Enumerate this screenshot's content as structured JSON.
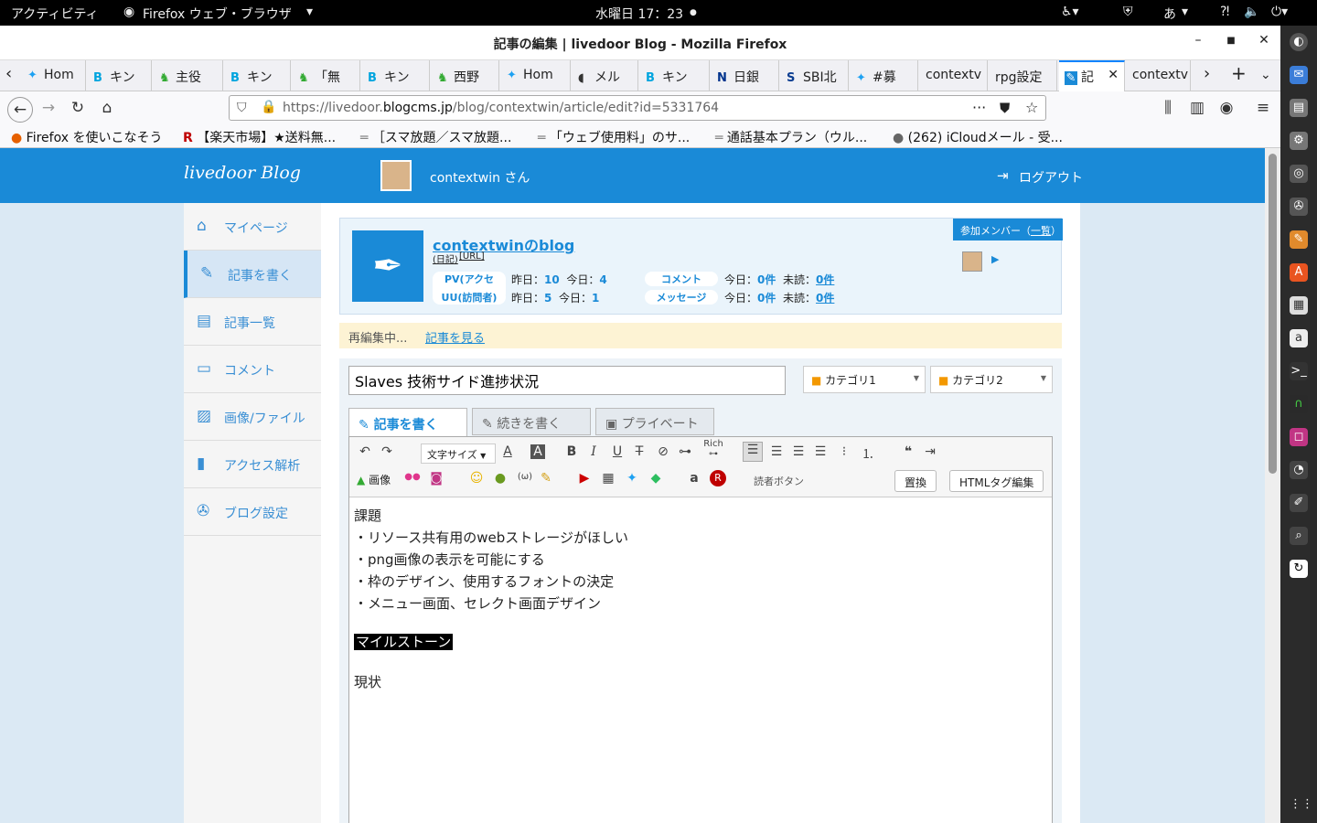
{
  "system": {
    "activities": "アクティビティ",
    "app_menu": "Firefox ウェブ・ブラウザ",
    "clock": "水曜日 17：23",
    "ime": "あ"
  },
  "window": {
    "title": "記事の編集 | livedoor Blog - Mozilla Firefox"
  },
  "tabs": [
    {
      "icon": "twitter",
      "label": "Hom"
    },
    {
      "icon": "B",
      "label": "キン"
    },
    {
      "icon": "cat",
      "label": "主役"
    },
    {
      "icon": "B",
      "label": "キン"
    },
    {
      "icon": "cat",
      "label": "「無"
    },
    {
      "icon": "B",
      "label": "キン"
    },
    {
      "icon": "cat",
      "label": "西野"
    },
    {
      "icon": "twitter",
      "label": "Hom"
    },
    {
      "icon": "c",
      "label": "メル"
    },
    {
      "icon": "B",
      "label": "キン"
    },
    {
      "icon": "nikkei",
      "label": "日銀"
    },
    {
      "icon": "sbi",
      "label": "SBI北"
    },
    {
      "icon": "twitter",
      "label": "#募"
    },
    {
      "icon": "",
      "label": "contextv"
    },
    {
      "icon": "",
      "label": "rpg設定"
    },
    {
      "icon": "pen",
      "label": "記"
    },
    {
      "icon": "",
      "label": "contextv"
    }
  ],
  "nav": {
    "url_prefix": "https://livedoor.",
    "url_domain": "blogcms.jp",
    "url_path": "/blog/contextwin/article/edit?id=5331764"
  },
  "bookmarks": [
    "Firefox を使いこなそう",
    "【楽天市場】★送料無...",
    "［スマ放題／スマ放題...",
    "「ウェブ使用料」のサ...",
    "通話基本プラン（ウル...",
    "(262) iCloudメール - 受..."
  ],
  "blog_header": {
    "logo": "livedoor Blog",
    "user": "contextwin さん",
    "logout": "ログアウト"
  },
  "sidebar": [
    {
      "icon": "home-icon",
      "label": "マイページ"
    },
    {
      "icon": "pen-icon",
      "label": "記事を書く"
    },
    {
      "icon": "list-icon",
      "label": "記事一覧"
    },
    {
      "icon": "comment-icon",
      "label": "コメント"
    },
    {
      "icon": "image-icon",
      "label": "画像/ファイル"
    },
    {
      "icon": "chart-icon",
      "label": "アクセス解析"
    },
    {
      "icon": "wrench-icon",
      "label": "ブログ設定"
    }
  ],
  "blog_info": {
    "name": "contextwinのblog",
    "tag1": "(日記)",
    "tag2": "[URL]",
    "members_label": "参加メンバー（",
    "members_link": "一覧",
    "members_close": "）",
    "pv_label": "PV(アクセス)",
    "uu_label": "UU(訪問者)",
    "comment_label": "コメント",
    "message_label": "メッセージ",
    "yesterday": "昨日：",
    "today": "今日：",
    "today_full": "今日：",
    "unread": "未読：",
    "pv_yesterday": "10",
    "pv_today": "4",
    "uu_yesterday": "5",
    "uu_today": "1",
    "comment_today": "0件",
    "comment_unread": "0件",
    "message_today": "0件",
    "message_unread": "0件"
  },
  "notice": {
    "text": "再編集中...",
    "link": "記事を見る"
  },
  "editor": {
    "title_value": "Slaves 技術サイド進捗状況",
    "category1": "カテゴリ1",
    "category2": "カテゴリ2",
    "tabs": [
      "記事を書く",
      "続きを書く",
      "プライベート"
    ],
    "font_size": "文字サイズ",
    "image_btn": "画像",
    "reader_btn": "読者ボタン",
    "replace_btn": "置換",
    "html_btn": "HTMLタグ編集",
    "rich_label": "Rich",
    "body": [
      "課題",
      "・リソース共有用のwebストレージがほしい",
      "・png画像の表示を可能にする",
      "・枠のデザイン、使用するフォントの決定",
      "・メニュー画面、セレクト画面デザイン"
    ],
    "milestone": "マイルストーン",
    "status": "現状"
  }
}
